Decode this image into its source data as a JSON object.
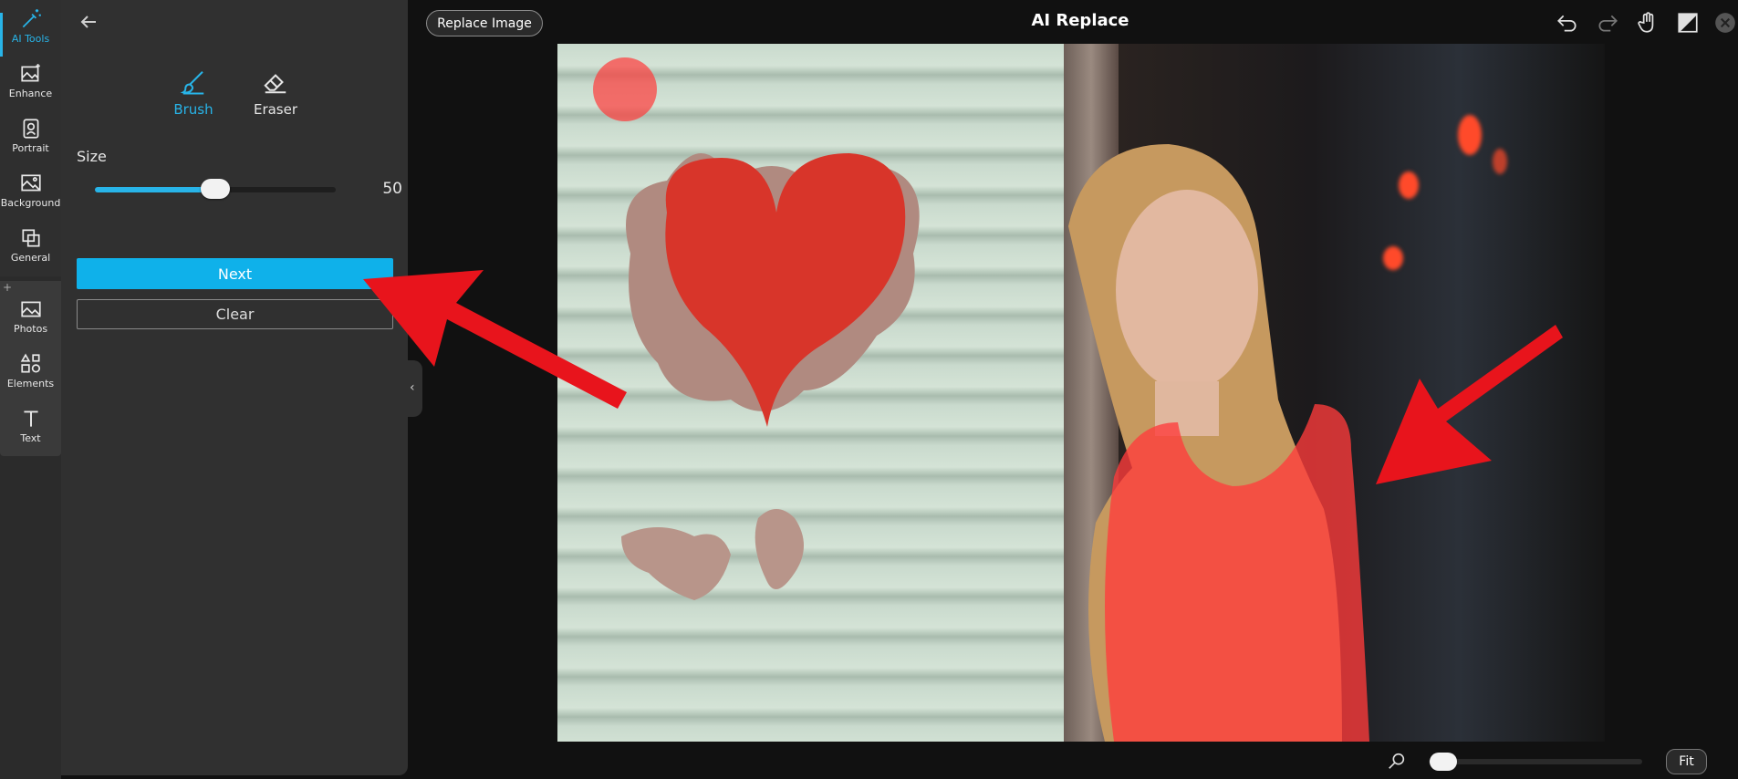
{
  "rail": {
    "items": [
      {
        "label": "AI Tools",
        "icon": "magic-wand-icon",
        "active": true
      },
      {
        "label": "Enhance",
        "icon": "image-sparkle-icon"
      },
      {
        "label": "Portrait",
        "icon": "portrait-icon"
      },
      {
        "label": "Background",
        "icon": "background-icon"
      },
      {
        "label": "General",
        "icon": "copy-icon"
      },
      {
        "label": "Photos",
        "icon": "photo-icon"
      },
      {
        "label": "Elements",
        "icon": "shapes-icon"
      },
      {
        "label": "Text",
        "icon": "text-icon"
      }
    ],
    "plus": "+"
  },
  "panel": {
    "tools": [
      {
        "label": "Brush",
        "icon": "brush-icon",
        "active": true
      },
      {
        "label": "Eraser",
        "icon": "eraser-icon"
      }
    ],
    "size_label": "Size",
    "size_value": "50",
    "size_fraction": 0.5,
    "next_label": "Next",
    "clear_label": "Clear"
  },
  "header": {
    "replace_label": "Replace Image",
    "title": "AI Replace"
  },
  "toolbar_icons": [
    "undo-icon",
    "redo-icon",
    "hand-icon",
    "compare-icon",
    "close-icon"
  ],
  "footer": {
    "fit_label": "Fit",
    "zoom_fraction": 0.02
  },
  "colors": {
    "accent": "#0fb1ea",
    "annotation_arrow": "#e8141c",
    "mask": "#ff3b3b"
  }
}
